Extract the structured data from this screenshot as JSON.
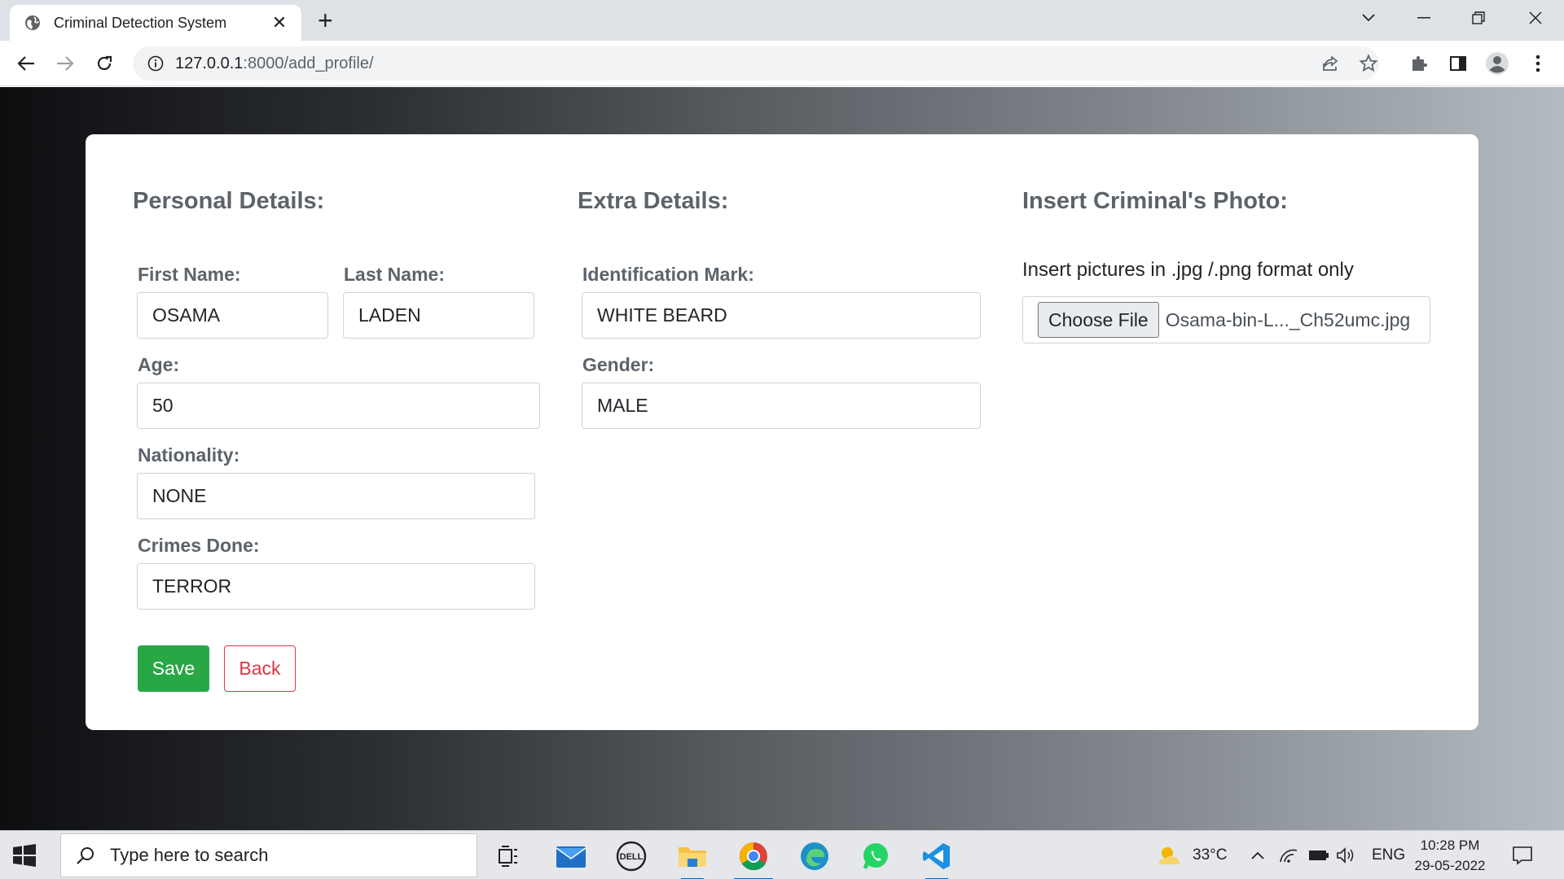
{
  "browser": {
    "tab_title": "Criminal Detection System",
    "url_host": "127.0.0.1",
    "url_rest": ":8000/add_profile/"
  },
  "form": {
    "personal_title": "Personal Details:",
    "extra_title": "Extra Details:",
    "photo_title": "Insert Criminal's Photo:",
    "first_name_label": "First Name:",
    "first_name_value": "OSAMA",
    "last_name_label": "Last Name:",
    "last_name_value": "LADEN",
    "age_label": "Age:",
    "age_value": "50",
    "nationality_label": "Nationality:",
    "nationality_value": "NONE",
    "crimes_label": "Crimes Done:",
    "crimes_value": "TERROR",
    "id_mark_label": "Identification Mark:",
    "id_mark_value": "WHITE BEARD",
    "gender_label": "Gender:",
    "gender_value": "MALE",
    "photo_note": "Insert pictures in .jpg /.png format only",
    "choose_file_label": "Choose File",
    "file_name": "Osama-bin-L..._Ch52umc.jpg",
    "save_label": "Save",
    "back_label": "Back"
  },
  "taskbar": {
    "search_placeholder": "Type here to search",
    "temperature": "33°C",
    "language": "ENG",
    "time": "10:28 PM",
    "date": "29-05-2022"
  },
  "colors": {
    "save": "#28a745",
    "back": "#dc3545",
    "label": "#5c636a"
  }
}
